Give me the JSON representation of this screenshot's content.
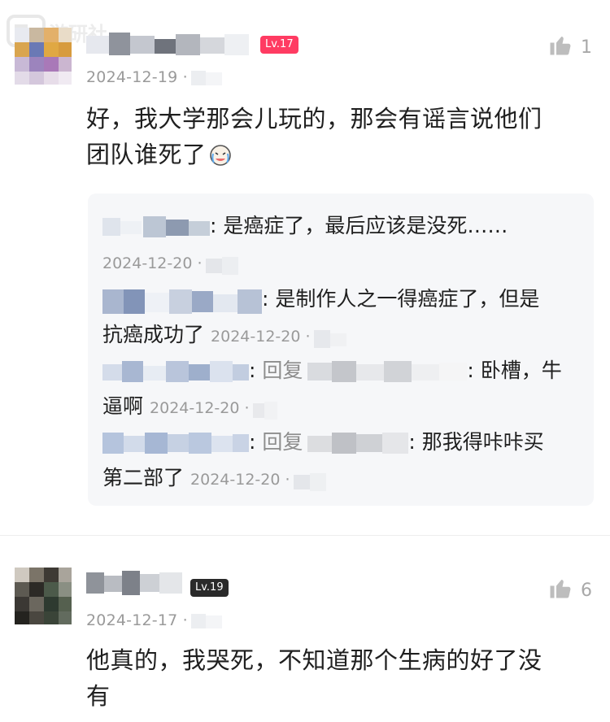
{
  "watermark": {
    "text": "游研社"
  },
  "comments": [
    {
      "level": "Lv.17",
      "level_color": "#ff3b62",
      "date": "2024-12-19 ·",
      "likes": "1",
      "text_line1": "好，我大学那会儿玩的，那会有谣言说他们",
      "text_line2": "团队谁死了",
      "replies": [
        {
          "prefix": ": ",
          "text": "是癌症了，最后应该是没死……",
          "date": "2024-12-20 ·"
        },
        {
          "prefix": ": ",
          "text": "是制作人之一得癌症了，但是",
          "text2": "抗癌成功了",
          "date": "2024-12-20 ·"
        },
        {
          "prefix": ": ",
          "reply_word": "回复",
          "text": "卧槽，牛",
          "text2": "逼啊",
          "date": "2024-12-20 ·"
        },
        {
          "prefix": ": ",
          "reply_word": "回复",
          "text": "那我得咔咔买",
          "text2": "第二部了",
          "date": "2024-12-20 ·"
        }
      ]
    },
    {
      "level": "Lv.19",
      "level_color": "#2a2a2a",
      "date": "2024-12-17 ·",
      "likes": "6",
      "text_line1": "他真的，我哭死，不知道那个生病的好了没",
      "text_line2": "有"
    }
  ],
  "icons": {
    "like": "thumbs-up-icon",
    "emoji": "crying-face-emoji-icon"
  }
}
